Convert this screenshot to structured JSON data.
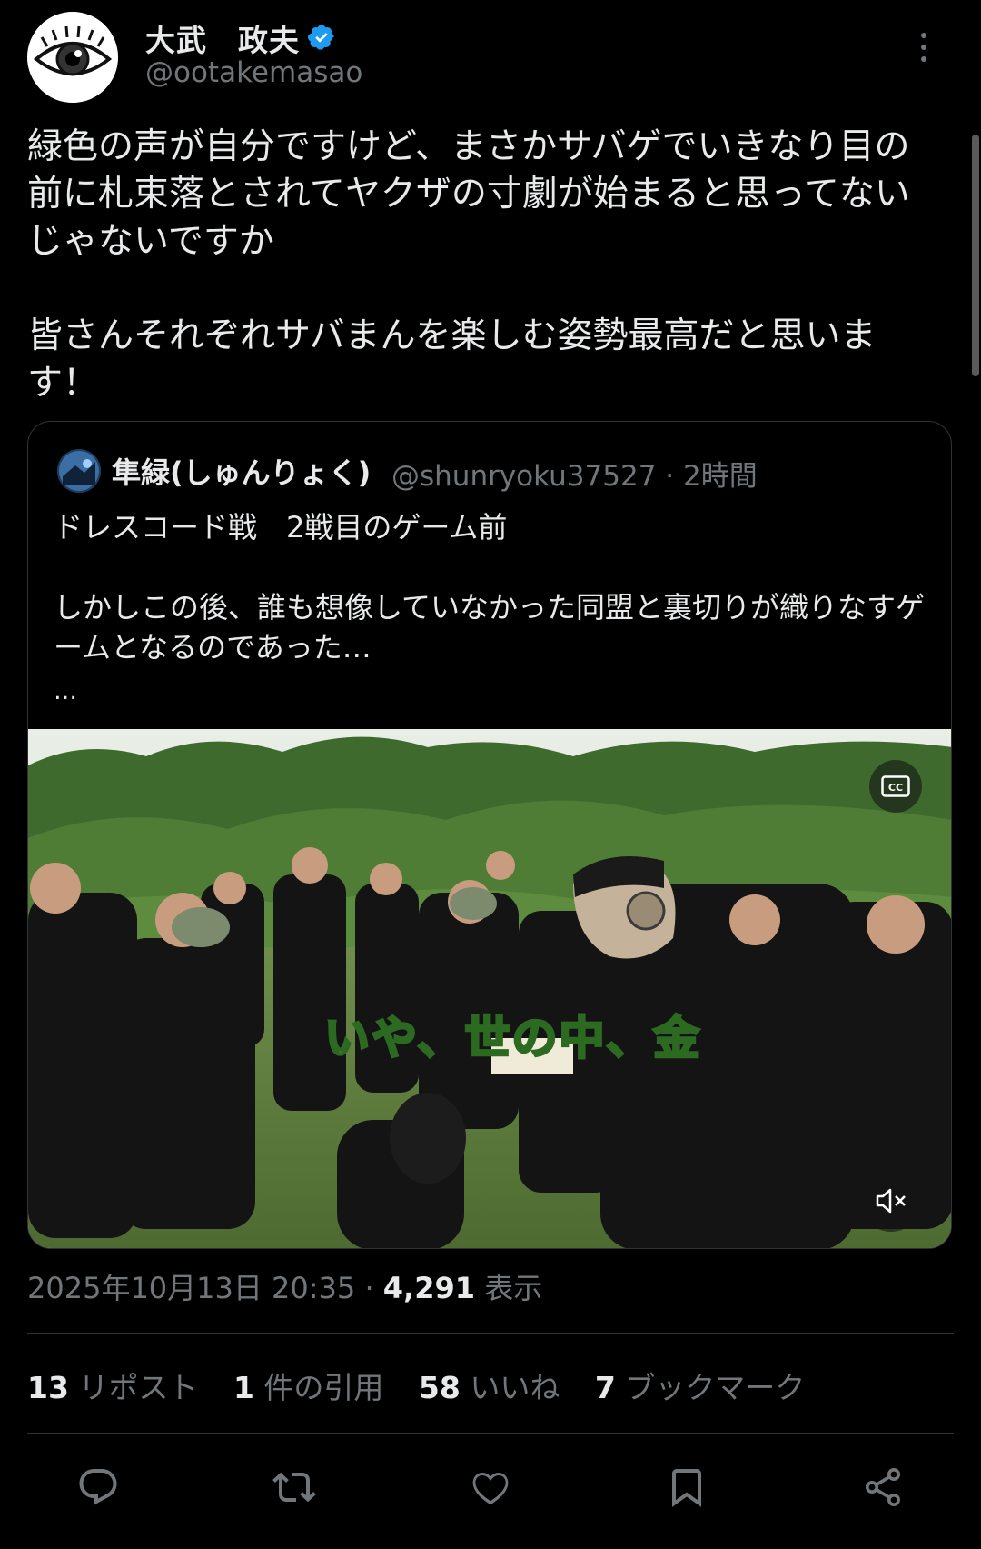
{
  "author": {
    "display_name": "大武　政夫",
    "handle": "@ootakemasao",
    "verified_icon": "verified-badge-icon",
    "avatar_icon": "eye-avatar"
  },
  "tweet": {
    "text": "緑色の声が自分ですけど、まさかサバゲでいきなり目の前に札束落とされてヤクザの寸劇が始まると思ってないじゃないですか\n\n皆さんそれぞれサバまんを楽しむ姿勢最高だと思います！"
  },
  "quoted": {
    "display_name": "隼緑(しゅんりょく)",
    "handle": "@shunryoku37527",
    "time": "· 2時間",
    "text": "ドレスコード戦　2戦目のゲーム前\n\nしかしこの後、誰も想像していなかった同盟と裏切りが織りなすゲームとなるのであった…",
    "ellipsis": "…",
    "video_caption": "いや、世の中、金",
    "cc_icon": "cc-icon",
    "mute_icon": "muted-speaker-icon"
  },
  "meta": {
    "timestamp": "2025年10月13日 20:35 · ",
    "views": "4,291",
    "views_label": " 表示"
  },
  "stats": {
    "reposts_count": "13",
    "reposts_label": " リポスト",
    "quotes_count": "1",
    "quotes_label": " 件の引用",
    "likes_count": "58",
    "likes_label": " いいね",
    "bookmarks_count": "7",
    "bookmarks_label": " ブックマーク"
  },
  "actions": [
    "reply-icon",
    "repost-icon",
    "like-icon",
    "bookmark-icon",
    "share-icon"
  ],
  "colors": {
    "background": "#000000",
    "text": "#e7e9ea",
    "secondary": "#71767b",
    "verified": "#1d9bf0",
    "divider": "#2f3336"
  }
}
